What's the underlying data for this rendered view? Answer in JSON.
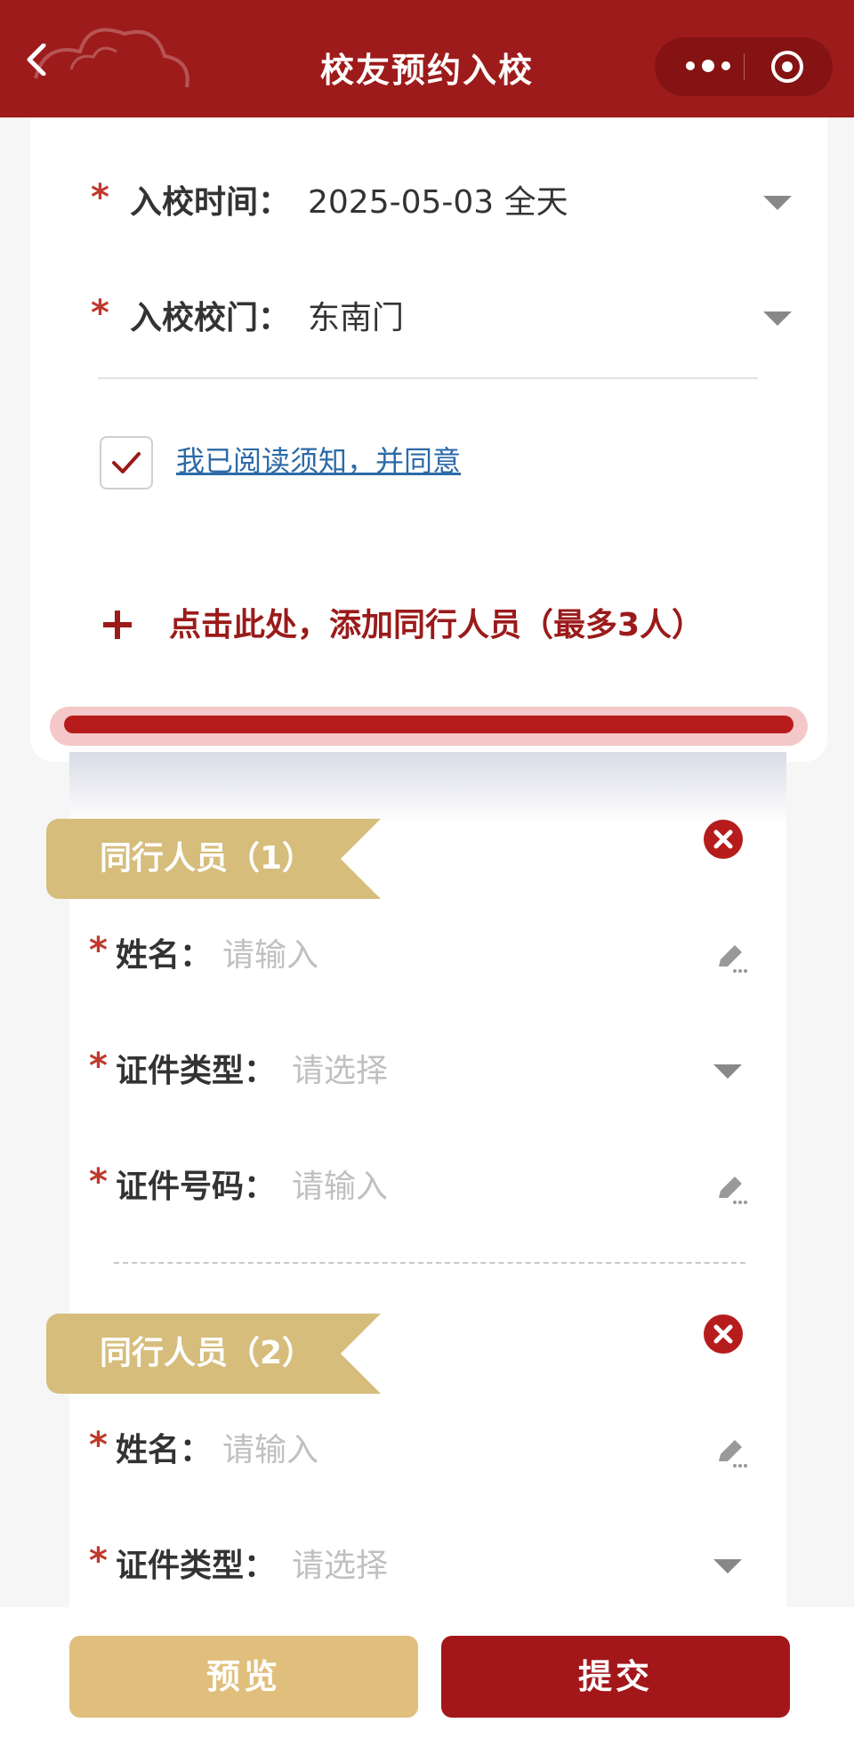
{
  "header": {
    "title": "校友预约入校"
  },
  "form": {
    "time": {
      "required": "*",
      "label": "入校时间：",
      "value": "2025-05-03 全天"
    },
    "gate": {
      "required": "*",
      "label": "入校校门：",
      "value": "东南门"
    },
    "agree": {
      "checked": true,
      "text": "我已阅读须知，并同意"
    },
    "add_companion": {
      "plus": "+",
      "text": "点击此处，添加同行人员（最多3人）"
    }
  },
  "companions": [
    {
      "title": "同行人员（1）",
      "name": {
        "required": "*",
        "label": "姓名：",
        "placeholder": "请输入"
      },
      "id_type": {
        "required": "*",
        "label": "证件类型：",
        "placeholder": "请选择"
      },
      "id_number": {
        "required": "*",
        "label": "证件号码：",
        "placeholder": "请输入"
      }
    },
    {
      "title": "同行人员（2）",
      "name": {
        "required": "*",
        "label": "姓名：",
        "placeholder": "请输入"
      },
      "id_type": {
        "required": "*",
        "label": "证件类型：",
        "placeholder": "请选择"
      }
    }
  ],
  "actions": {
    "preview": "预览",
    "submit": "提交"
  },
  "colors": {
    "brand_red": "#9e1b1b",
    "gold": "#d6bd7c",
    "link_blue": "#2c6aa8"
  }
}
